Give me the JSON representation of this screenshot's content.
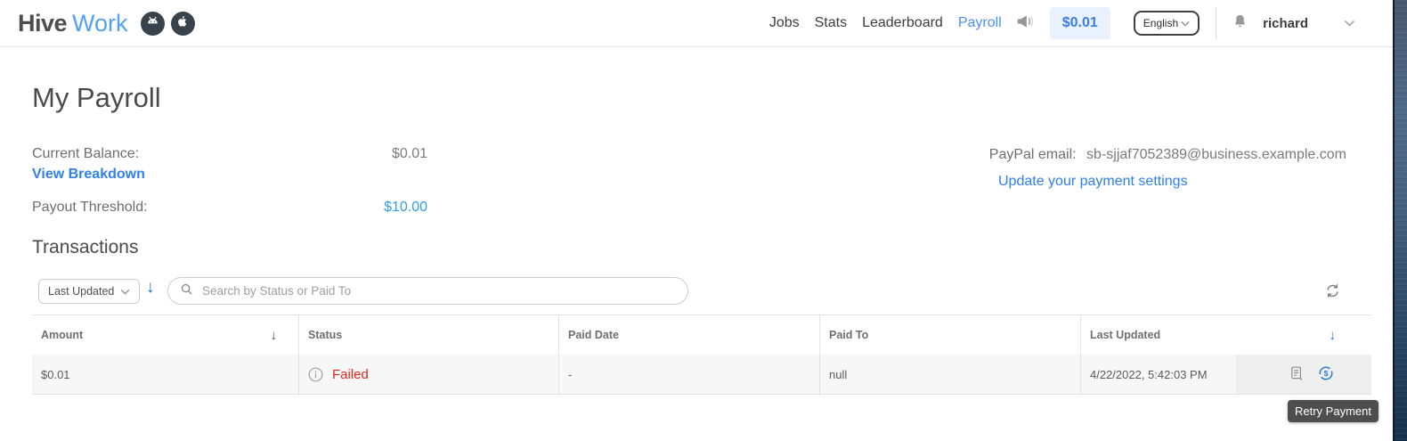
{
  "nav": {
    "brand": {
      "name_bold": "Hive",
      "name_light": "Work"
    },
    "links": [
      {
        "label": "Jobs"
      },
      {
        "label": "Stats"
      },
      {
        "label": "Leaderboard"
      },
      {
        "label": "Payroll"
      }
    ],
    "balance_badge": "$0.01",
    "language_button": "English",
    "username": "richard"
  },
  "payroll": {
    "title": "My Payroll",
    "current_balance_label": "Current Balance:",
    "current_balance_value": "$0.01",
    "view_breakdown_link": "View Breakdown",
    "payout_threshold_label": "Payout Threshold:",
    "payout_threshold_value": "$10.00",
    "paypal_email_label": "PayPal email:",
    "paypal_email_value": "sb-sjjaf7052389@business.example.com",
    "update_settings_link": "Update your payment settings"
  },
  "transactions": {
    "title": "Transactions",
    "sort_field": "Last Updated",
    "search_placeholder": "Search by Status or Paid To",
    "columns": [
      "Amount",
      "Status",
      "Paid Date",
      "Paid To",
      "Last Updated"
    ],
    "rows": [
      {
        "amount": "$0.01",
        "status": "Failed",
        "paid_date": "-",
        "paid_to": "null",
        "last_updated": "4/22/2022, 5:42:03 PM"
      }
    ],
    "tooltip": "Retry Payment"
  },
  "icons": {
    "sort_desc_arrow": "↓"
  },
  "colors": {
    "accent_blue": "#2f80ed",
    "brand_blue": "#53a0f8",
    "nav_active_blue": "#4a90f7",
    "failed_red": "#e1261d",
    "badge_bg": "#e9f1fd",
    "badge_text": "#3c7ee8"
  }
}
